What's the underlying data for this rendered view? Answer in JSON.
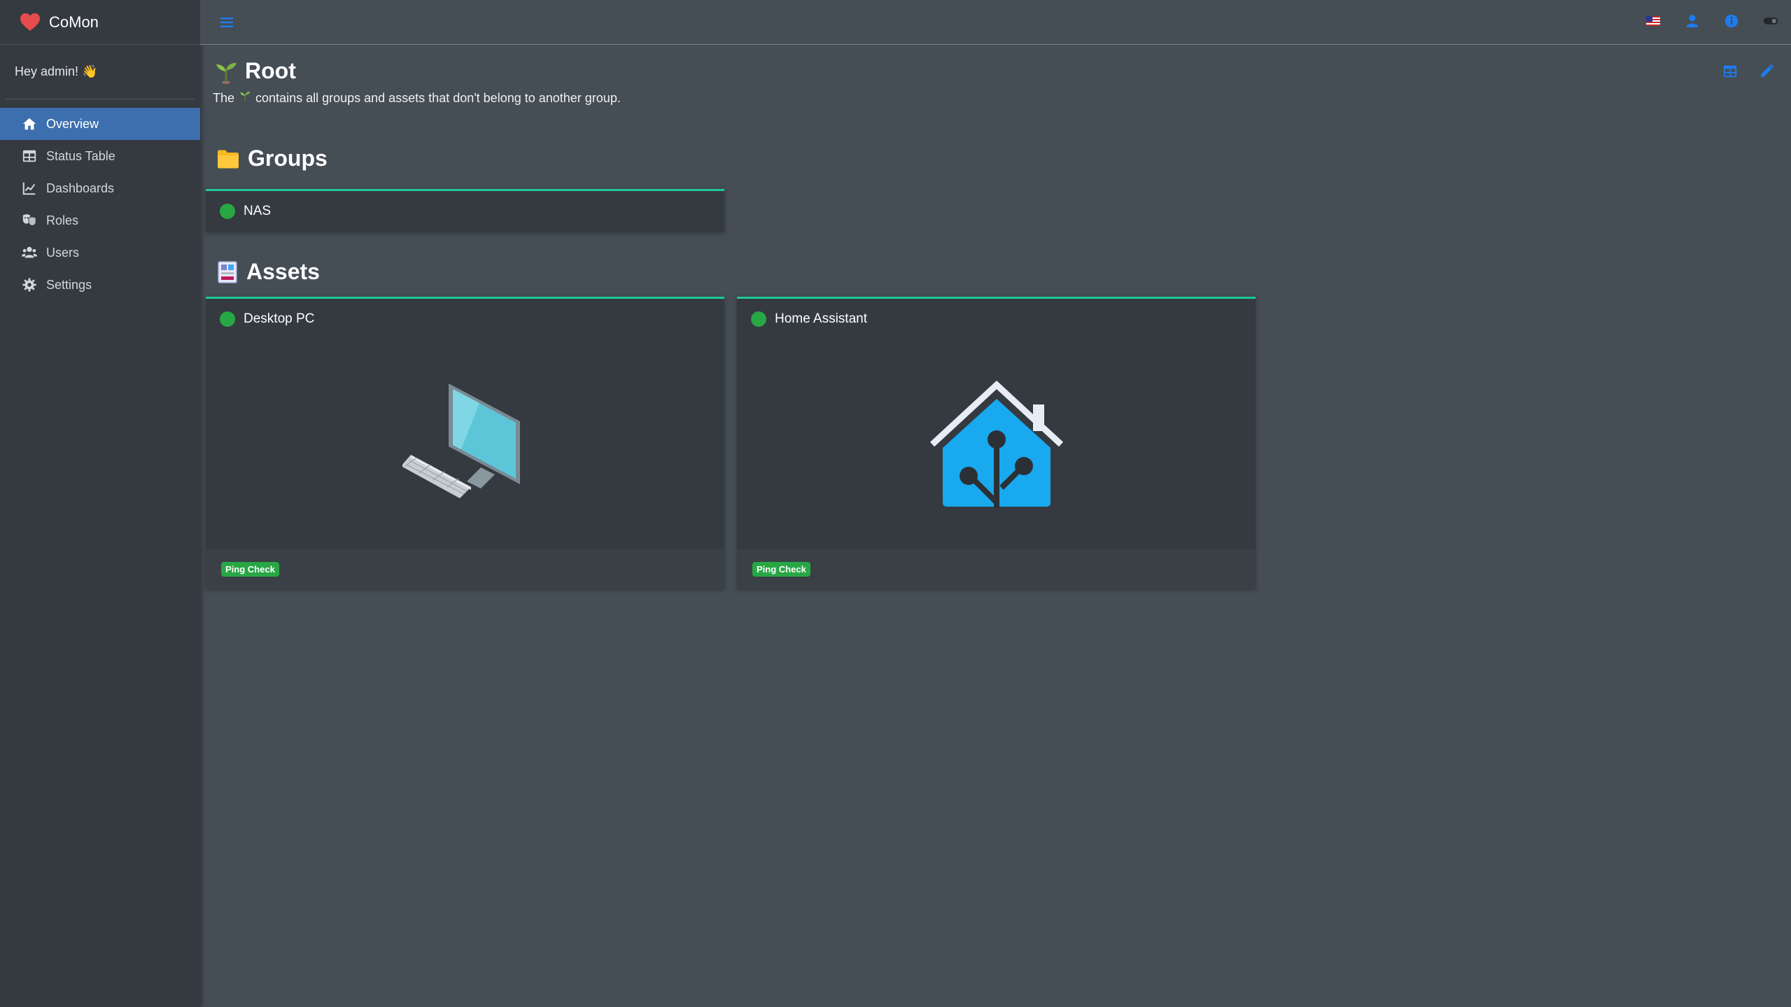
{
  "app": {
    "name": "CoMon",
    "greeting": "Hey admin! 👋"
  },
  "sidebar": {
    "items": [
      {
        "label": "Overview",
        "icon": "home-icon",
        "active": true
      },
      {
        "label": "Status Table",
        "icon": "table-icon"
      },
      {
        "label": "Dashboards",
        "icon": "chart-line-icon"
      },
      {
        "label": "Roles",
        "icon": "masks-icon"
      },
      {
        "label": "Users",
        "icon": "users-icon"
      },
      {
        "label": "Settings",
        "icon": "gear-icon"
      }
    ]
  },
  "topbar": {
    "icons": [
      "menu-icon",
      "us-flag-icon",
      "user-icon",
      "info-icon",
      "theme-toggle-icon"
    ]
  },
  "page": {
    "title": "Root",
    "desc_before": "The",
    "desc_after": "contains all groups and assets that don't belong to another group."
  },
  "groups": {
    "title": "Groups",
    "items": [
      {
        "name": "NAS",
        "status": "ok"
      }
    ]
  },
  "assets": {
    "title": "Assets",
    "items": [
      {
        "name": "Desktop PC",
        "status": "ok",
        "check": "Ping Check",
        "image": "desktop-pc-illustration"
      },
      {
        "name": "Home Assistant",
        "status": "ok",
        "check": "Ping Check",
        "image": "home-assistant-logo"
      }
    ]
  },
  "colors": {
    "accent": "#3d6faf",
    "status_ok": "#28a745",
    "card_border": "#20c997",
    "link_blue": "#1e7cf0"
  }
}
